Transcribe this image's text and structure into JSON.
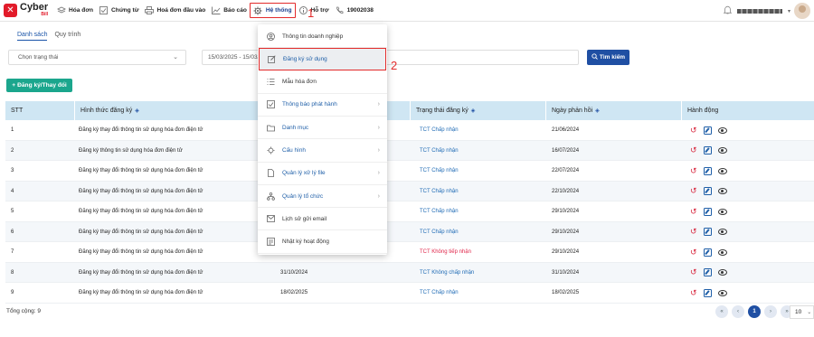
{
  "brand": {
    "logo_glyph": "✕",
    "name": "Cyber",
    "sub": "Bill"
  },
  "nav": [
    {
      "label": "Hóa đơn",
      "icon": "layers-icon"
    },
    {
      "label": "Chứng từ",
      "icon": "checkbox-icon"
    },
    {
      "label": "Hoá đơn đầu vào",
      "icon": "printer-icon"
    },
    {
      "label": "Báo cáo",
      "icon": "chart-icon"
    },
    {
      "label": "Hệ thống",
      "icon": "gear-icon"
    },
    {
      "label": "Hỗ trợ",
      "icon": "info-icon"
    },
    {
      "label": "19002038",
      "icon": "phone-icon"
    }
  ],
  "annotations": {
    "one": "1",
    "two": "2"
  },
  "tabs": [
    "Danh sách",
    "Quy trình"
  ],
  "filters": {
    "status_placeholder": "Chọn trạng thái",
    "date_range": "15/03/2025 - 15/03/",
    "search_button": "Tìm kiếm"
  },
  "add_button": "Đăng ký/Thay đổi",
  "table": {
    "headers": [
      "STT",
      "Hình thức đăng ký",
      "",
      "Trạng thái đăng ký",
      "Ngày phản hồi",
      "Hành động"
    ],
    "rows": [
      {
        "stt": "1",
        "type": "Đăng ký thay đổi thông tin sử dụng hóa đơn điện tử",
        "date": "",
        "status": "TCT Chấp nhận",
        "status_kind": "ok",
        "resp": "21/06/2024"
      },
      {
        "stt": "2",
        "type": "Đăng ký thông tin sử dụng hóa đơn điện tử",
        "date": "",
        "status": "TCT Chấp nhận",
        "status_kind": "ok",
        "resp": "16/07/2024"
      },
      {
        "stt": "3",
        "type": "Đăng ký thay đổi thông tin sử dụng hóa đơn điện tử",
        "date": "",
        "status": "TCT Chấp nhận",
        "status_kind": "ok",
        "resp": "22/07/2024"
      },
      {
        "stt": "4",
        "type": "Đăng ký thay đổi thông tin sử dụng hóa đơn điện tử",
        "date": "",
        "status": "TCT Chấp nhận",
        "status_kind": "ok",
        "resp": "22/10/2024"
      },
      {
        "stt": "5",
        "type": "Đăng ký thay đổi thông tin sử dụng hóa đơn điện tử",
        "date": "",
        "status": "TCT Chấp nhận",
        "status_kind": "ok",
        "resp": "29/10/2024"
      },
      {
        "stt": "6",
        "type": "Đăng ký thay đổi thông tin sử dụng hóa đơn điện tử",
        "date": "",
        "status": "TCT Chấp nhận",
        "status_kind": "ok",
        "resp": "29/10/2024"
      },
      {
        "stt": "7",
        "type": "Đăng ký thay đổi thông tin sử dụng hóa đơn điện tử",
        "date": "",
        "status": "TCT Không tiếp nhận",
        "status_kind": "bad",
        "resp": "29/10/2024"
      },
      {
        "stt": "8",
        "type": "Đăng ký thay đổi thông tin sử dụng hóa đơn điện tử",
        "date": "31/10/2024",
        "status": "TCT Không chấp nhận",
        "status_kind": "ok",
        "resp": "31/10/2024"
      },
      {
        "stt": "9",
        "type": "Đăng ký thay đổi thông tin sử dụng hóa đơn điện tử",
        "date": "18/02/2025",
        "status": "TCT Chấp nhận",
        "status_kind": "ok",
        "resp": "18/02/2025"
      }
    ]
  },
  "total": "Tổng cộng: 9",
  "pagination": {
    "first": "«",
    "prev": "‹",
    "current": "1",
    "next": "›",
    "last": "»",
    "page_size": "10"
  },
  "dropdown": {
    "items": [
      {
        "label": "Thông tin doanh nghiệp",
        "icon": "user-circle-icon",
        "submenu": false
      },
      {
        "label": "Đăng ký sử dụng",
        "icon": "edit-icon",
        "submenu": false,
        "highlighted": true
      },
      {
        "label": "Mẫu hóa đơn",
        "icon": "list-icon",
        "submenu": false
      },
      {
        "label": "Thông báo phát hành",
        "icon": "checkbox-icon",
        "submenu": true
      },
      {
        "label": "Danh mục",
        "icon": "folder-icon",
        "submenu": true
      },
      {
        "label": "Cấu hình",
        "icon": "gear-icon",
        "submenu": true
      },
      {
        "label": "Quản lý xử lý file",
        "icon": "file-icon",
        "submenu": true
      },
      {
        "label": "Quản lý tổ chức",
        "icon": "org-icon",
        "submenu": true
      },
      {
        "label": "Lịch sử gửi email",
        "icon": "mail-icon",
        "submenu": false
      },
      {
        "label": "Nhật ký hoạt động",
        "icon": "log-icon",
        "submenu": false
      }
    ]
  },
  "colors": {
    "primary": "#1f4fa3",
    "green": "#1ba68d",
    "red_accent": "#e32b2b",
    "header_bg": "#cfe6f3"
  }
}
